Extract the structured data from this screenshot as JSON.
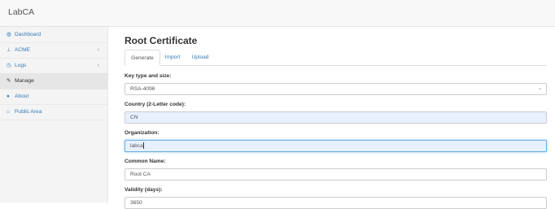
{
  "app": {
    "brand": "LabCA"
  },
  "sidebar": {
    "items": [
      {
        "icon": "dashboard-icon",
        "glyph": "◍",
        "label": "Dashboard",
        "chevron": ""
      },
      {
        "icon": "sitemap-icon",
        "glyph": "⊥",
        "label": "ACME",
        "chevron": "‹"
      },
      {
        "icon": "logs-icon",
        "glyph": "◷",
        "label": "Logs",
        "chevron": "‹"
      },
      {
        "icon": "wrench-icon",
        "glyph": "✎",
        "label": "Manage",
        "chevron": ""
      },
      {
        "icon": "comment-icon",
        "glyph": "●",
        "label": "About",
        "chevron": ""
      },
      {
        "icon": "home-icon",
        "glyph": "⌂",
        "label": "Public Area",
        "chevron": ""
      }
    ],
    "active_index": 3
  },
  "main": {
    "title": "Root Certificate",
    "tabs": [
      {
        "label": "Generate",
        "active": true
      },
      {
        "label": "Import",
        "active": false
      },
      {
        "label": "Upload",
        "active": false
      }
    ]
  },
  "form": {
    "key_type": {
      "label": "Key type and size:",
      "value": "RSA-4096"
    },
    "country": {
      "label": "Country (2-Letter code):",
      "value": "CN"
    },
    "organization": {
      "label": "Organization:",
      "value": "labca"
    },
    "common_name": {
      "label": "Common Name:",
      "value": "Root CA"
    },
    "validity": {
      "label": "Validity (days):",
      "value": "3650"
    }
  },
  "colors": {
    "link": "#337ab7",
    "autofill": "#e8f0fe",
    "focus": "#66afe9"
  }
}
